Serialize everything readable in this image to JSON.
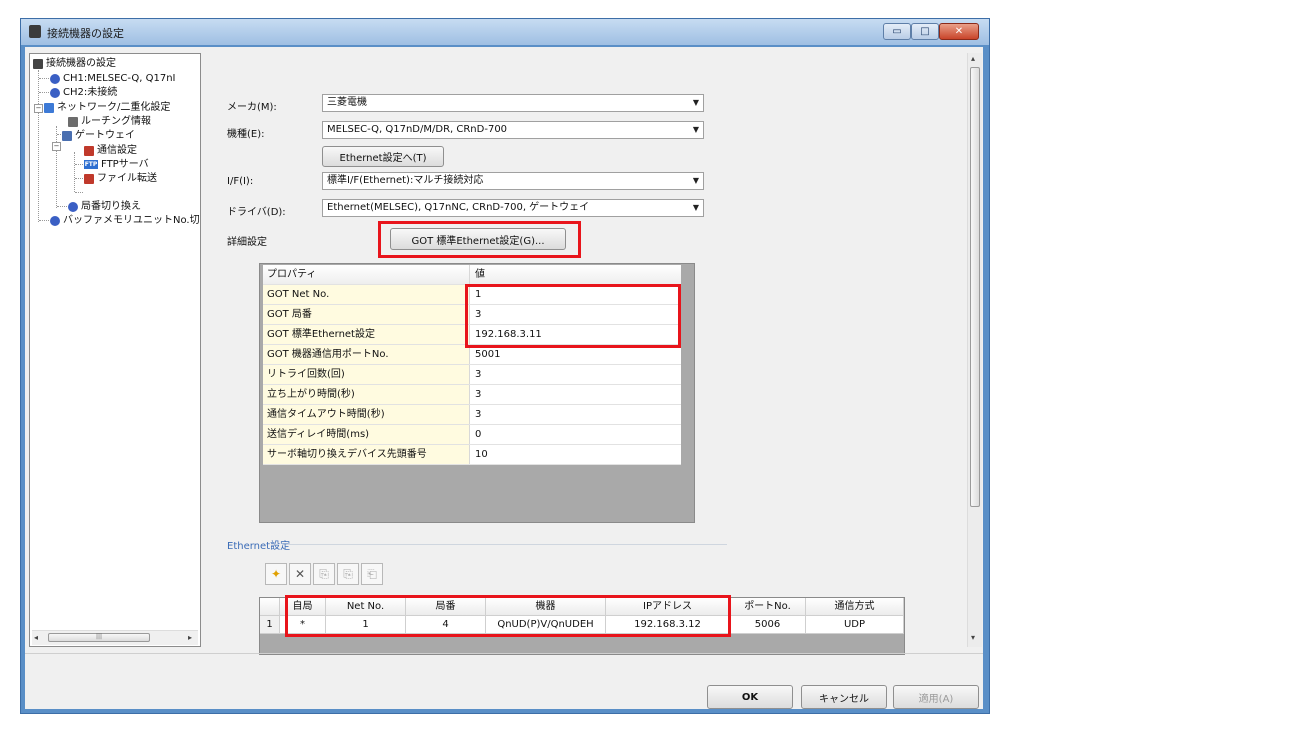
{
  "window": {
    "title": "接続機器の設定",
    "min": "▭",
    "max": "□",
    "close": "✕"
  },
  "tree": {
    "root": "接続機器の設定",
    "ch1": "CH1:MELSEC-Q, Q17nI",
    "ch2": "CH2:未接続",
    "network": "ネットワーク/二重化設定",
    "routing": "ルーチング情報",
    "gateway": "ゲートウェイ",
    "comm": "通信設定",
    "ftp": "FTPサーバ",
    "file": "ファイル転送",
    "station": "局番切り換え",
    "buffer": "バッファメモリユニットNo.切",
    "ftp_badge": "FTP"
  },
  "form": {
    "maker_label": "メーカ(M):",
    "maker_value": "三菱電機",
    "model_label": "機種(E):",
    "model_value": "MELSEC-Q, Q17nD/M/DR, CRnD-700",
    "eth_btn": "Ethernet設定へ(T)",
    "if_label": "I/F(I):",
    "if_value": "標準I/F(Ethernet):マルチ接続対応",
    "driver_label": "ドライバ(D):",
    "driver_value": "Ethernet(MELSEC), Q17nNC, CRnD-700, ゲートウェイ",
    "detail_label": "詳細設定",
    "got_btn": "GOT 標準Ethernet設定(G)..."
  },
  "property_grid": {
    "header": {
      "name": "プロパティ",
      "value": "値"
    },
    "rows": [
      {
        "name": "GOT Net No.",
        "value": "1"
      },
      {
        "name": "GOT 局番",
        "value": "3"
      },
      {
        "name": "GOT 標準Ethernet設定",
        "value": "192.168.3.11"
      },
      {
        "name": "GOT 機器通信用ポートNo.",
        "value": "5001"
      },
      {
        "name": "リトライ回数(回)",
        "value": "3"
      },
      {
        "name": "立ち上がり時間(秒)",
        "value": "3"
      },
      {
        "name": "通信タイムアウト時間(秒)",
        "value": "3"
      },
      {
        "name": "送信ディレイ時間(ms)",
        "value": "0"
      },
      {
        "name": "サーボ軸切り換えデバイス先頭番号",
        "value": "10"
      }
    ]
  },
  "ethernet": {
    "title": "Ethernet設定",
    "toolbar": [
      "✦",
      "✕",
      "⎘",
      "⎘",
      "⎗"
    ],
    "headers": [
      "自局",
      "Net No.",
      "局番",
      "機器",
      "IPアドレス",
      "ポートNo.",
      "通信方式"
    ],
    "rows": [
      {
        "num": "1",
        "cells": [
          "*",
          "1",
          "4",
          "QnUD(P)V/QnUDEH",
          "192.168.3.12",
          "5006",
          "UDP"
        ]
      }
    ]
  },
  "buttons": {
    "ok": "OK",
    "cancel": "キャンセル",
    "apply": "適用(A)"
  },
  "colors": {
    "highlight": "#e8141b",
    "section_title": "#3b6cb7",
    "property_name_bg": "#fffbe0"
  }
}
